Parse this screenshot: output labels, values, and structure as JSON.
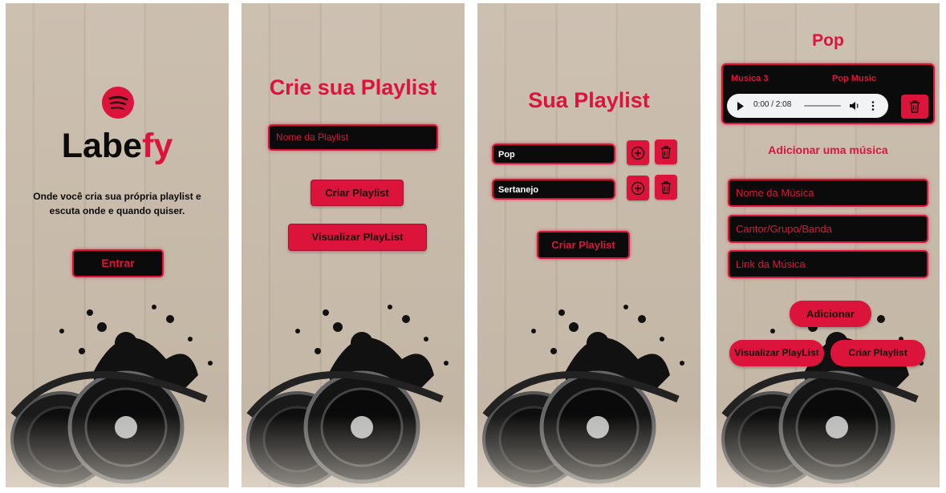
{
  "colors": {
    "accent": "#dc143c",
    "dark": "#0b0b0b",
    "background": "#c6b8a7"
  },
  "screen1": {
    "logo_icon": "spotify-like-icon",
    "brand_part1": "Labe",
    "brand_part2": "fy",
    "tagline_line1": "Onde você cria sua própria playlist e",
    "tagline_line2": "escuta onde e quando quiser.",
    "enter_button": "Entrar"
  },
  "screen2": {
    "title": "Crie sua Playlist",
    "name_placeholder": "Nome da Playlist",
    "create_button": "Criar Playlist",
    "view_button": "Visualizar PlayList"
  },
  "screen3": {
    "title": "Sua Playlist",
    "playlists": [
      {
        "name": "Pop",
        "add_icon": "plus-circle-icon",
        "delete_icon": "trash-icon"
      },
      {
        "name": "Sertanejo",
        "add_icon": "plus-circle-icon",
        "delete_icon": "trash-icon"
      }
    ],
    "create_button": "Criar Playlist"
  },
  "screen4": {
    "title": "Pop",
    "track": {
      "name": "Musica 3",
      "artist": "Pop Music",
      "time": "0:00 / 2:08",
      "delete_icon": "trash-icon"
    },
    "add_title": "Adicionar uma música",
    "fields": {
      "song_name": "Nome da Música",
      "artist": "Cantor/Grupo/Banda",
      "link": "Link da Música"
    },
    "add_button": "Adicionar",
    "view_button": "Visualizar PlayList",
    "create_button": "Criar Playlist"
  }
}
